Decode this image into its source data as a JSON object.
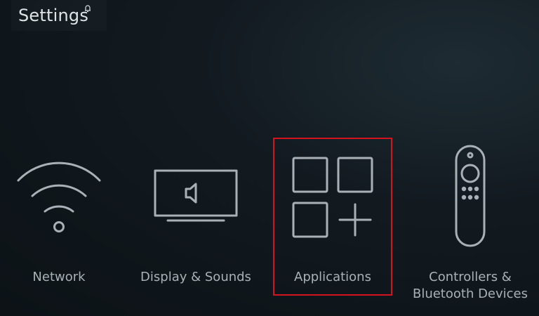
{
  "header": {
    "title": "Settings",
    "notification_icon": "bell-icon"
  },
  "tiles": [
    {
      "label": "Network",
      "icon": "wifi-icon",
      "selected": false
    },
    {
      "label": "Display & Sounds",
      "icon": "tv-speaker-icon",
      "selected": false
    },
    {
      "label": "Applications",
      "icon": "apps-grid-icon",
      "selected": true
    },
    {
      "label_line1": "Controllers &",
      "label_line2": "Bluetooth Devices",
      "icon": "remote-control-icon",
      "selected": false
    }
  ],
  "colors": {
    "selection_outline": "#d4131f",
    "icon_stroke": "#a9b1b6",
    "title_text": "#dfe3e5"
  }
}
